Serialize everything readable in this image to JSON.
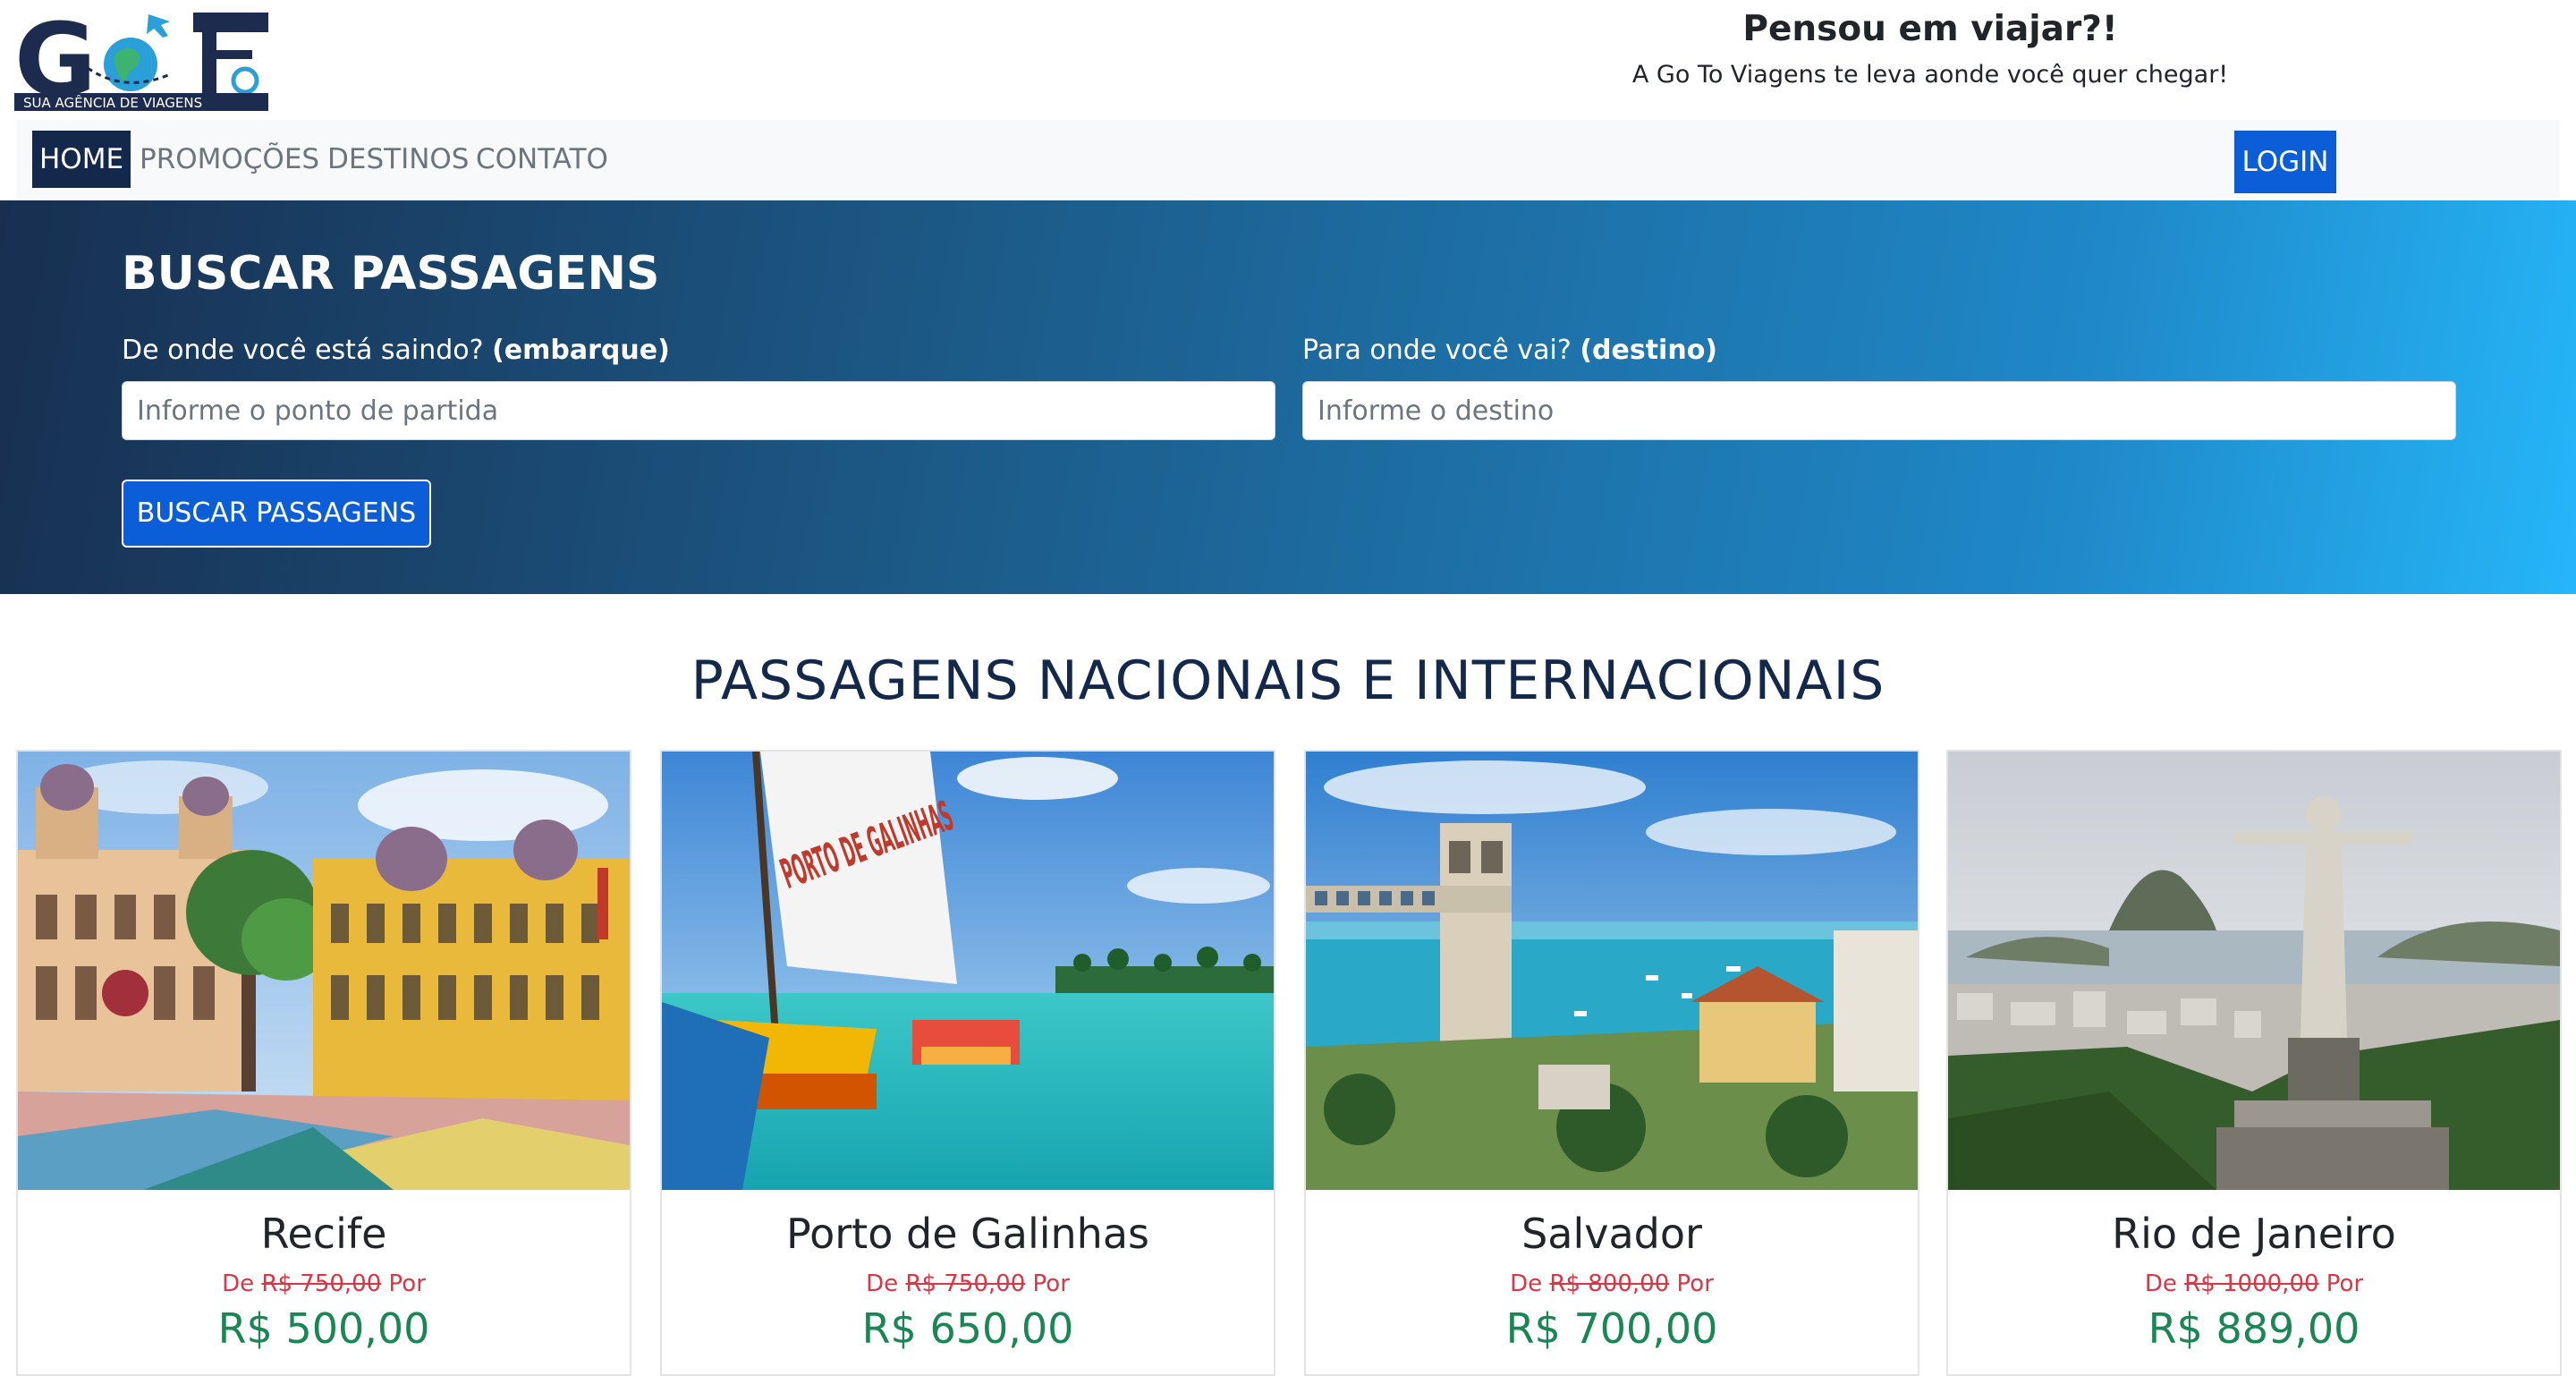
{
  "logo": {
    "text": "GoTo",
    "subtitle": "SUA AGÊNCIA DE VIAGENS"
  },
  "header": {
    "title": "Pensou em viajar?!",
    "subtitle": "A Go To Viagens te leva aonde você quer chegar!"
  },
  "nav": {
    "items": [
      {
        "label": "HOME",
        "active": true
      },
      {
        "label": "PROMOÇÕES"
      },
      {
        "label": "DESTINOS"
      },
      {
        "label": "CONTATO"
      }
    ],
    "login": "LOGIN"
  },
  "search": {
    "title": "BUSCAR PASSAGENS",
    "origin_label": "De onde você está saindo?",
    "origin_label_bold": "(embarque)",
    "origin_placeholder": "Informe o ponto de partida",
    "origin_value": "",
    "destination_label": "Para onde você vai?",
    "destination_label_bold": "(destino)",
    "destination_placeholder": "Informe o destino",
    "destination_value": "",
    "button": "BUSCAR PASSAGENS"
  },
  "section": {
    "title": "PASSAGENS NACIONAIS E INTERNACIONAIS"
  },
  "cards": [
    {
      "name": "Recife",
      "from_prefix": "De",
      "old_price": "R$ 750,00",
      "to_prefix": "Por",
      "new_price": "R$ 500,00"
    },
    {
      "name": "Porto de Galinhas",
      "from_prefix": "De",
      "old_price": "R$ 750,00",
      "to_prefix": "Por",
      "new_price": "R$ 650,00",
      "sail_text": "PORTO DE GALINHAS"
    },
    {
      "name": "Salvador",
      "from_prefix": "De",
      "old_price": "R$ 800,00",
      "to_prefix": "Por",
      "new_price": "R$ 700,00"
    },
    {
      "name": "Rio de Janeiro",
      "from_prefix": "De",
      "old_price": "R$ 1000,00",
      "to_prefix": "Por",
      "new_price": "R$ 889,00"
    }
  ],
  "colors": {
    "navy": "#14284b",
    "primary": "#0b5ed7",
    "old_price": "#dc3545",
    "new_price": "#198754"
  }
}
